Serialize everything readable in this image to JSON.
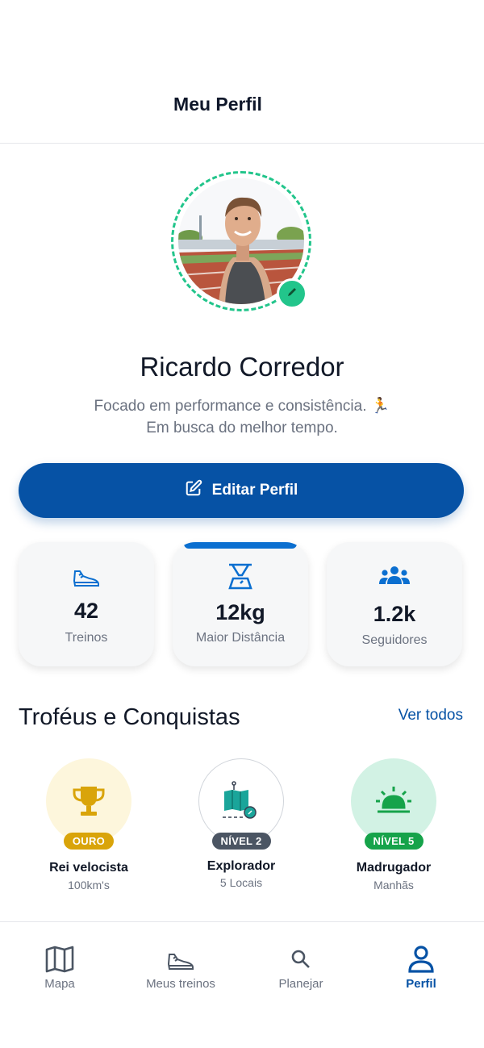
{
  "header": {
    "title": "Meu Perfil"
  },
  "colors": {
    "primary": "#0652a5",
    "accent_green": "#22c58b",
    "gold": "#d9a40a",
    "gray_badge": "#4b5563",
    "green_badge": "#16a34a"
  },
  "profile": {
    "name": "Ricardo Corredor",
    "bio_line1": "Focado em performance e consistência. 🏃",
    "bio_line2": "Em busca do melhor tempo.",
    "edit_avatar_icon": "pencil-icon"
  },
  "edit_button": {
    "label": "Editar Perfil",
    "icon": "edit-icon"
  },
  "stats": [
    {
      "icon": "sneaker-icon",
      "value": "42",
      "label": "Treinos"
    },
    {
      "icon": "scale-icon",
      "value": "12kg",
      "label": "Maior Distância"
    },
    {
      "icon": "group-icon",
      "value": "1.2k",
      "label": "Seguidores"
    }
  ],
  "trophies_section": {
    "title": "Troféus e Conquistas",
    "see_all": "Ver todos"
  },
  "trophies": [
    {
      "icon": "trophy-icon",
      "badge": "OURO",
      "name": "Rei velocista",
      "subtitle": "100km's"
    },
    {
      "icon": "map-explorer-icon",
      "badge": "NÍVEL 2",
      "name": "Explorador",
      "subtitle": "5 Locais"
    },
    {
      "icon": "sunrise-icon",
      "badge": "NÍVEL 5",
      "name": "Madrugador",
      "subtitle": "Manhãs"
    }
  ],
  "nav": [
    {
      "label": "Mapa",
      "icon": "map-icon",
      "active": false
    },
    {
      "label": "Meus treinos",
      "icon": "sneaker-icon",
      "active": false
    },
    {
      "label": "Planejar",
      "icon": "search-icon",
      "active": false
    },
    {
      "label": "Perfil",
      "icon": "person-icon",
      "active": true
    }
  ]
}
